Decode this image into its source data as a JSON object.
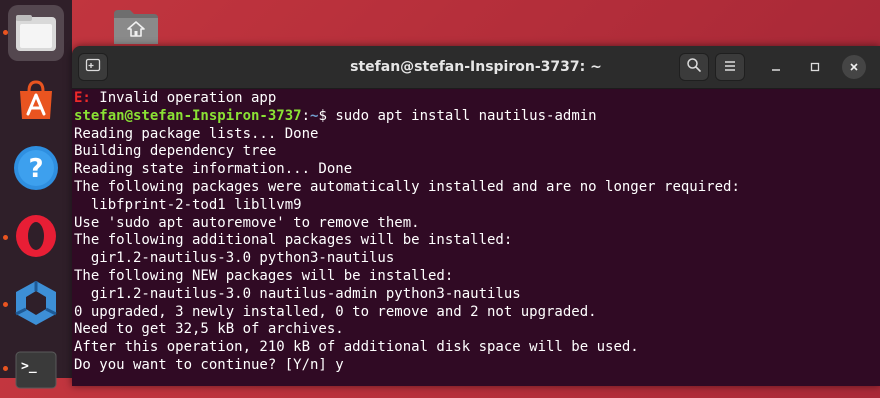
{
  "window": {
    "title": "stefan@stefan-Inspiron-3737: ~"
  },
  "terminal": {
    "error_line": {
      "prefix": "E:",
      "text": " Invalid operation app"
    },
    "prompt": {
      "user_host": "stefan@stefan-Inspiron-3737",
      "sep": ":",
      "path": "~",
      "symbol": "$",
      "command": " sudo apt install nautilus-admin"
    },
    "output": [
      "Reading package lists... Done",
      "Building dependency tree",
      "Reading state information... Done",
      "The following packages were automatically installed and are no longer required:",
      "  libfprint-2-tod1 libllvm9",
      "Use 'sudo apt autoremove' to remove them.",
      "The following additional packages will be installed:",
      "  gir1.2-nautilus-3.0 python3-nautilus",
      "The following NEW packages will be installed:",
      "  gir1.2-nautilus-3.0 nautilus-admin python3-nautilus",
      "0 upgraded, 3 newly installed, 0 to remove and 2 not upgraded.",
      "Need to get 32,5 kB of archives.",
      "After this operation, 210 kB of additional disk space will be used.",
      "Do you want to continue? [Y/n] y"
    ]
  },
  "dock": {
    "items": [
      {
        "name": "files-icon"
      },
      {
        "name": "software-icon"
      },
      {
        "name": "help-icon"
      },
      {
        "name": "opera-icon"
      },
      {
        "name": "app-icon"
      },
      {
        "name": "terminal-icon"
      }
    ]
  },
  "icons": {
    "new_tab": "new-tab-icon",
    "search": "search-icon",
    "menu": "hamburger-menu-icon",
    "minimize": "minimize-icon",
    "maximize": "maximize-icon",
    "close": "close-icon",
    "home_folder": "home-folder-icon"
  },
  "colors": {
    "terminal_bg": "#300a24",
    "prompt_user": "#8ae234",
    "prompt_path": "#729fcf",
    "error": "#ef2929",
    "titlebar": "#2c2c2c",
    "dock": "#2f1f29"
  }
}
